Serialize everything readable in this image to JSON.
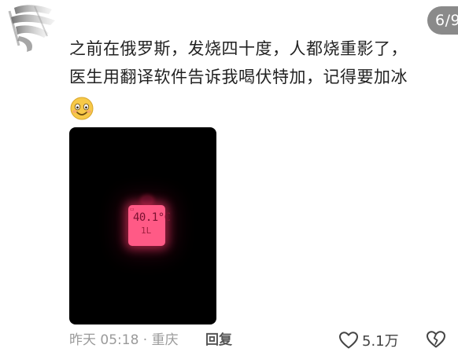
{
  "comment": {
    "lines": [
      "之前在俄罗斯，发烧四十度，人都烧重影了，",
      "医生用翻译软件告诉我喝伏特加，记得要加冰"
    ],
    "emoji": "smile-emoji"
  },
  "badge": {
    "page": "6/9"
  },
  "photo": {
    "thermometer_reading": "40.1°C",
    "thermometer_sub": "1L"
  },
  "meta": {
    "time_location": "昨天 05:18 · 重庆",
    "reply_label": "回复",
    "like_count": "5.1万"
  },
  "icons": {
    "like": "heart-outline-icon",
    "dislike": "broken-heart-icon"
  },
  "colors": {
    "text": "#222222",
    "meta": "#9a9a9a",
    "badge_bg": "#8a8a8a",
    "thermo_screen": "#ff5a86"
  }
}
